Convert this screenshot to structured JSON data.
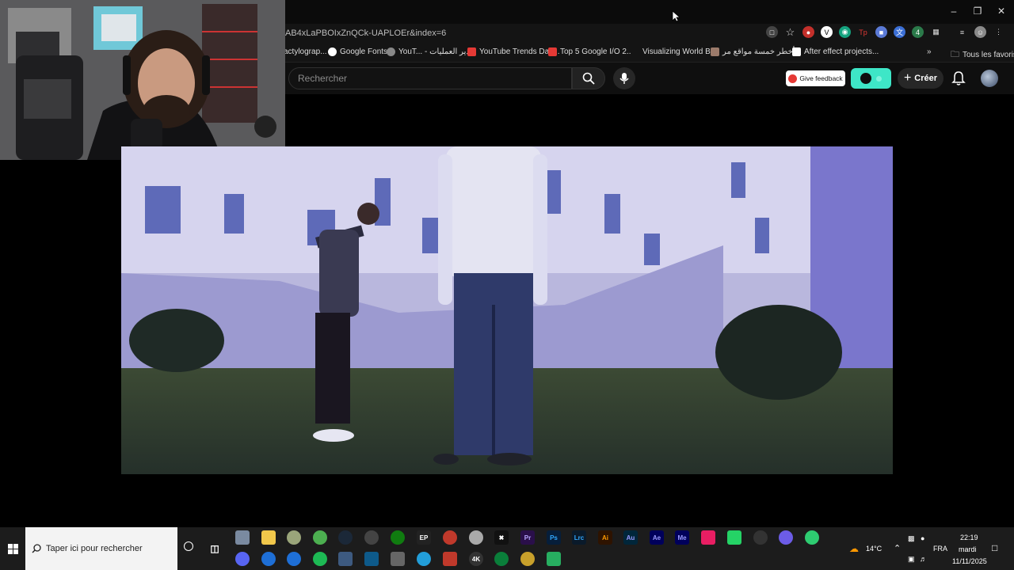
{
  "browser": {
    "url": "AB4xLaPBOIxZnQCk-UAPLOEr&index=6",
    "bookmarks": [
      {
        "label": "actylograp..."
      },
      {
        "label": "Google Fonts"
      },
      {
        "label": "YouT... - مدير العمليات"
      },
      {
        "label": "YouTube Trends Das..."
      },
      {
        "label": "Top 5 Google I/O 2..."
      },
      {
        "label": "Visualizing World Bi..."
      },
      {
        "label": "أخطر خمسة مواقع مر..."
      },
      {
        "label": "After effect projects..."
      }
    ],
    "all_favorites": "Tous les favoris"
  },
  "youtube": {
    "search_placeholder": "Rechercher",
    "feedback_label": "Give feedback",
    "create_label": "Créer"
  },
  "taskbar": {
    "search_placeholder": "Taper ici pour rechercher",
    "temperature": "14°C",
    "language": "FRA",
    "time": "22:19",
    "day": "mardi",
    "date": "11/11/2025",
    "app_labels": [
      "Pr",
      "Ps",
      "Lrc",
      "Ai",
      "Au",
      "Ae",
      "Me"
    ]
  },
  "colors": {
    "chrome_bg": "#0b0b0b",
    "youtube_bg": "#0f0f0f",
    "teal_button": "#3ee6c7",
    "taskbar_bg": "#1c1c1c"
  }
}
